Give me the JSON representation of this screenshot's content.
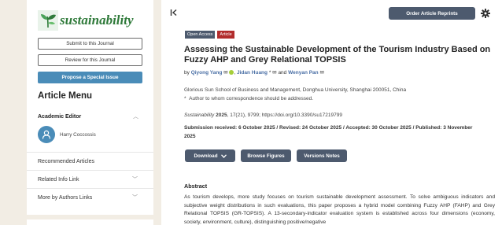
{
  "sidebar": {
    "logo_text": "sustainability",
    "submit_label": "Submit to this Journal",
    "review_label": "Review for this Journal",
    "propose_label": "Propose a Special Issue",
    "menu_title": "Article Menu",
    "editor_heading": "Academic Editor",
    "editor_name": "Harry Coccossis",
    "links": [
      "Recommended Articles",
      "Related Info Link",
      "More by Authors Links"
    ]
  },
  "header": {
    "order_label": "Order Article Reprints"
  },
  "article": {
    "badges": [
      {
        "label": "Open Access",
        "color": "#4d5a6e"
      },
      {
        "label": "Article",
        "color": "#b22d2d"
      }
    ],
    "title": "Assessing the Sustainable Development of the Tourism Industry Based on Fuzzy AHP and Grey Relational TOPSIS",
    "by": "by",
    "authors": [
      "Qiyong Yang",
      "Jidan Huang",
      "Wenyan Pan"
    ],
    "author_suffix": " *",
    "and": "and",
    "affiliation": "Glorious Sun School of Business and Management, Donghua University, Shanghai 200051, China",
    "correspondence_mark": "*",
    "correspondence": "Author to whom correspondence should be addressed.",
    "journal_name": "Sustainability",
    "journal_year": "2025",
    "journal_rest": ", 17(21), 9799; https://doi.org/10.3390/su17219799",
    "dates": "Submission received: 6 October 2025 / Revised: 24 October 2025 / Accepted: 30 October 2025 / Published: 3 November 2025",
    "buttons": {
      "download": "Download",
      "figures": "Browse Figures",
      "versions": "Versions Notes"
    },
    "abstract_title": "Abstract",
    "abstract": "As tourism develops, more study focuses on tourism sustainable development assessment. To solve ambiguous indicators and subjective weight distributions in such evaluations, this paper proposes a hybrid model combining Fuzzy AHP (FAHP) and Grey Relational TOPSIS (GR-TOPSIS). A 13-secondary-indicator evaluation system is established across four dimensions (economy, society, environment, culture), distinguishing positive/negative"
  }
}
